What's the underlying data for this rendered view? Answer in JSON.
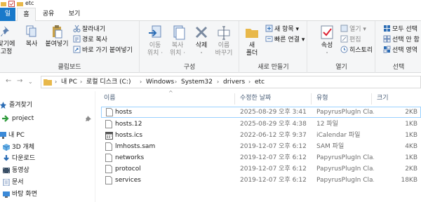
{
  "window": {
    "title": "etc"
  },
  "ribbon_tabs": [
    {
      "label": "일"
    },
    {
      "label": "홈"
    },
    {
      "label": "공유"
    },
    {
      "label": "보기"
    }
  ],
  "clipboard": {
    "group_label": "클립보드",
    "pin_label": "찾기에\n고정",
    "copy_label": "복사",
    "paste_label": "붙여넣기",
    "cut_label": "잘라내기",
    "copy_path_label": "경로 복사",
    "paste_shortcut_label": "바로 가기 붙여넣기"
  },
  "organize": {
    "group_label": "구성",
    "move_to_label": "이동\n위치 ·",
    "copy_to_label": "복사\n위치 ·",
    "delete_label": "삭제\n·",
    "rename_label": "이름\n바꾸기"
  },
  "new": {
    "group_label": "새로 만들기",
    "new_folder_label": "새\n폴더",
    "new_item_label": "새 항목 ▾",
    "easy_access_label": "빠른 연결 ▾"
  },
  "open": {
    "group_label": "열기",
    "properties_label": "속성\n·",
    "open_label": "열기 ▾",
    "edit_label": "편집",
    "history_label": "히스토리"
  },
  "select": {
    "group_label": "선택",
    "select_all_label": "모두 선택",
    "select_none_label": "선택 안 함",
    "invert_label": "선택 영역"
  },
  "address": {
    "crumbs": [
      "내 PC",
      "로컬 디스크 (C:)",
      "Windows",
      "System32",
      "drivers",
      "etc"
    ]
  },
  "nav_pane": {
    "items": [
      {
        "label": "즐겨찾기",
        "icon": "star-icon"
      },
      {
        "label": "project",
        "icon": "arrow-folder-icon"
      },
      {
        "label": "내 PC",
        "icon": "computer-icon"
      },
      {
        "label": "3D 개체",
        "icon": "3d-objects-icon"
      },
      {
        "label": "다운로드",
        "icon": "download-icon"
      },
      {
        "label": "동영상",
        "icon": "video-icon"
      },
      {
        "label": "문서",
        "icon": "document-icon"
      },
      {
        "label": "바탕 화면",
        "icon": "desktop-icon"
      }
    ]
  },
  "file_list": {
    "columns": {
      "name": "이름",
      "modified": "수정한 날짜",
      "type": "유형",
      "size": "크기"
    },
    "rows": [
      {
        "name": "hosts",
        "modified": "2025-08-29 오후 3:41",
        "type": "PapyrusPlugIn Cla...",
        "size": "2KB",
        "selected": true
      },
      {
        "name": "hosts.12",
        "modified": "2025-08-29 오후 4:38",
        "type": "12 파일",
        "size": "1KB"
      },
      {
        "name": "hosts.ics",
        "modified": "2022-06-12 오후 9:37",
        "type": "iCalendar 파일",
        "size": "1KB"
      },
      {
        "name": "lmhosts.sam",
        "modified": "2019-12-07 오후 6:12",
        "type": "SAM 파일",
        "size": "4KB"
      },
      {
        "name": "networks",
        "modified": "2019-12-07 오후 6:12",
        "type": "PapyrusPlugIn Cla...",
        "size": "1KB"
      },
      {
        "name": "protocol",
        "modified": "2019-12-07 오후 6:12",
        "type": "PapyrusPlugIn Cla...",
        "size": "2KB"
      },
      {
        "name": "services",
        "modified": "2019-12-07 오후 6:12",
        "type": "PapyrusPlugIn Cla...",
        "size": "18KB"
      }
    ]
  },
  "colors": {
    "accent": "#1979ca",
    "folder": "#e8b84a",
    "selection_border": "#99d1ff"
  }
}
